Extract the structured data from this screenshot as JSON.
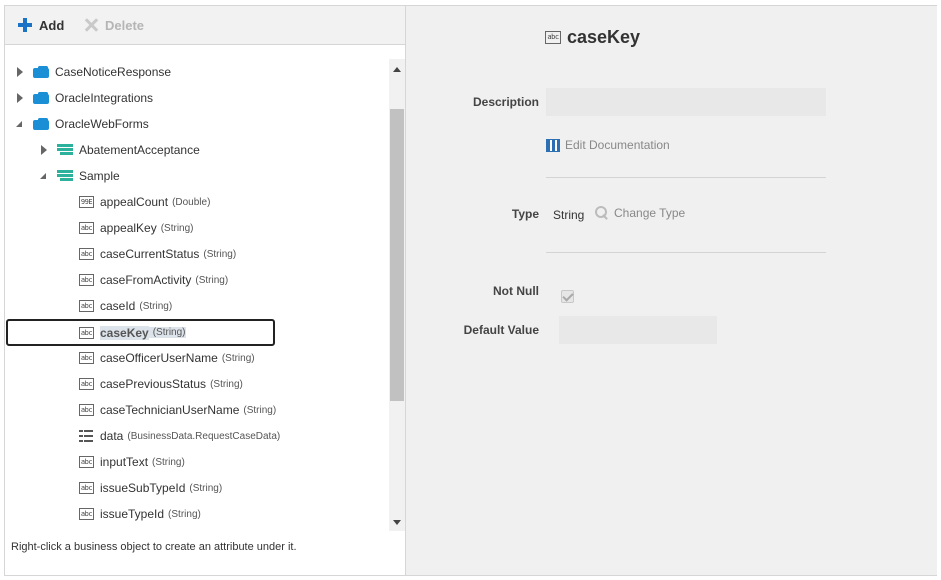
{
  "toolbar": {
    "add_label": "Add",
    "delete_label": "Delete",
    "add_icon": "plus-icon",
    "delete_icon": "close-icon"
  },
  "tree": {
    "items": [
      {
        "label": "CaseNoticeResponse",
        "level": 0,
        "expanded": false,
        "icon": "business-object-icon"
      },
      {
        "label": "OracleIntegrations",
        "level": 0,
        "expanded": false,
        "icon": "business-object-icon"
      },
      {
        "label": "OracleWebForms",
        "level": 0,
        "expanded": true,
        "icon": "business-object-icon"
      },
      {
        "label": "AbatementAcceptance",
        "level": 1,
        "expanded": false,
        "icon": "data-object-icon"
      },
      {
        "label": "Sample",
        "level": 1,
        "expanded": true,
        "icon": "data-object-icon"
      }
    ],
    "attributes": [
      {
        "name": "appealCount",
        "type": "(Double)",
        "glyph": "99E"
      },
      {
        "name": "appealKey",
        "type": "(String)",
        "glyph": "abc"
      },
      {
        "name": "caseCurrentStatus",
        "type": "(String)",
        "glyph": "abc"
      },
      {
        "name": "caseFromActivity",
        "type": "(String)",
        "glyph": "abc"
      },
      {
        "name": "caseId",
        "type": "(String)",
        "glyph": "abc"
      },
      {
        "name": "caseKey",
        "type": "(String)",
        "glyph": "abc",
        "selected": true
      },
      {
        "name": "caseOfficerUserName",
        "type": "(String)",
        "glyph": "abc"
      },
      {
        "name": "casePreviousStatus",
        "type": "(String)",
        "glyph": "abc"
      },
      {
        "name": "caseTechnicianUserName",
        "type": "(String)",
        "glyph": "abc"
      },
      {
        "name": "data",
        "type": "(BusinessData.RequestCaseData)",
        "glyph": "list"
      },
      {
        "name": "inputText",
        "type": "(String)",
        "glyph": "abc"
      },
      {
        "name": "issueSubTypeId",
        "type": "(String)",
        "glyph": "abc"
      },
      {
        "name": "issueTypeId",
        "type": "(String)",
        "glyph": "abc"
      }
    ]
  },
  "hint": "Right-click a business object to create an attribute under it.",
  "detail": {
    "title": "caseKey",
    "title_glyph": "abc",
    "description_label": "Description",
    "description_value": "",
    "edit_doc_label": "Edit Documentation",
    "type_label": "Type",
    "type_value": "String",
    "change_type_label": "Change Type",
    "not_null_label": "Not Null",
    "not_null_checked": true,
    "default_value_label": "Default Value",
    "default_value": ""
  }
}
